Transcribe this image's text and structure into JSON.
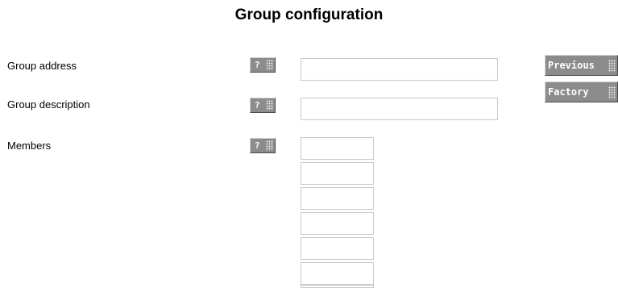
{
  "page": {
    "title": "Group configuration"
  },
  "fields": {
    "address_label": "Group address",
    "description_label": "Group description",
    "members_label": "Members",
    "address_value": "",
    "description_value": "",
    "member_values": [
      "",
      "",
      "",
      "",
      "",
      "",
      ""
    ]
  },
  "help": {
    "label": "?"
  },
  "actions": {
    "previous_label": "Previous",
    "factory_label": "Factory"
  },
  "colors": {
    "button_face": "#8c8c8c",
    "input_border": "#c8c8c8"
  }
}
